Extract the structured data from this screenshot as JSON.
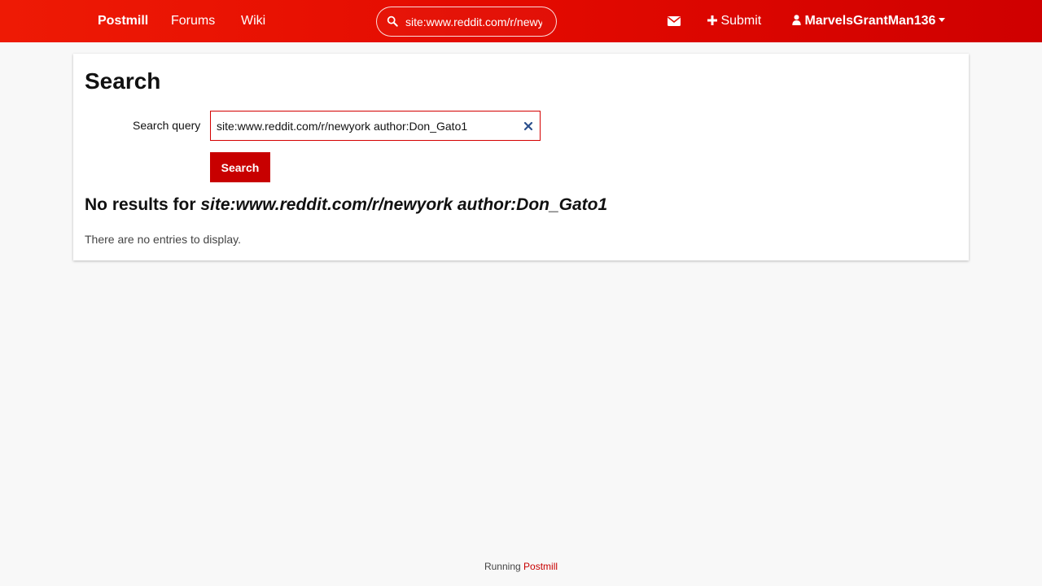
{
  "nav": {
    "brand": "Postmill",
    "forums": "Forums",
    "wiki": "Wiki",
    "search_value": "site:www.reddit.com/r/newyork author:Don_Gato1",
    "submit": "Submit",
    "username": "MarvelsGrantMan136",
    "icons": [
      "search-icon",
      "envelope-icon",
      "plus-icon",
      "user-icon",
      "caret-down-icon"
    ]
  },
  "main": {
    "title": "Search",
    "query_label": "Search query",
    "query_value": "site:www.reddit.com/r/newyork author:Don_Gato1",
    "search_button": "Search",
    "results_prefix": "No results for",
    "results_query": "site:www.reddit.com/r/newyork author:Don_Gato1",
    "empty_message": "There are no entries to display."
  },
  "footer": {
    "running_text": "Running",
    "link_text": "Postmill"
  },
  "colors": {
    "accent": "#c80000",
    "navbar_start": "#ee1a05",
    "navbar_end": "#cf0000",
    "background": "#f8f8f8",
    "clear_icon": "#2b4f8c"
  }
}
